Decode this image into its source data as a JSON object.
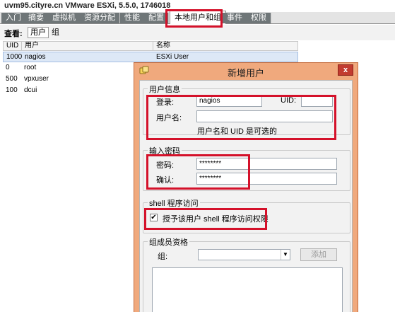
{
  "window": {
    "title": "uvm95.cityre.cn VMware ESXi, 5.5.0, 1746018"
  },
  "tabs": [
    {
      "label": "入门"
    },
    {
      "label": "摘要"
    },
    {
      "label": "虚拟机"
    },
    {
      "label": "资源分配"
    },
    {
      "label": "性能"
    },
    {
      "label": "配置"
    },
    {
      "label": "本地用户和组",
      "active": true
    },
    {
      "label": "事件"
    },
    {
      "label": "权限"
    }
  ],
  "view": {
    "label": "查看:",
    "users": "用户",
    "groups": "组"
  },
  "list": {
    "headers": {
      "uid": "UID",
      "user": "用户",
      "name": "名称"
    },
    "rows": [
      {
        "uid": "1000",
        "user": "nagios",
        "name": "ESXi User",
        "selected": true
      },
      {
        "uid": "0",
        "user": "root",
        "name": ""
      },
      {
        "uid": "500",
        "user": "vpxuser",
        "name": ""
      },
      {
        "uid": "100",
        "user": "dcui",
        "name": ""
      }
    ]
  },
  "dialog": {
    "title": "新增用户",
    "close": "x",
    "user_info": {
      "legend": "用户信息",
      "login_label": "登录:",
      "login_value": "nagios",
      "uid_label": "UID:",
      "uid_value": "",
      "username_label": "用户名:",
      "username_value": "",
      "note": "用户名和 UID 是可选的"
    },
    "password": {
      "legend": "输入密码",
      "password_label": "密码:",
      "password_value": "********",
      "confirm_label": "确认:",
      "confirm_value": "********"
    },
    "shell": {
      "legend": "shell 程序访问",
      "checkbox_label": "授予该用户 shell 程序访问权限",
      "checked": true,
      "check_glyph": "✔"
    },
    "membership": {
      "legend": "组成员资格",
      "group_label": "组:",
      "group_value": "",
      "arrow": "▼",
      "add_button": "添加"
    }
  },
  "colors": {
    "highlight": "#d4112a",
    "dialog_frame": "#f0a97d",
    "tab_inactive": "#6f7678",
    "selection": "#dde8f6"
  }
}
